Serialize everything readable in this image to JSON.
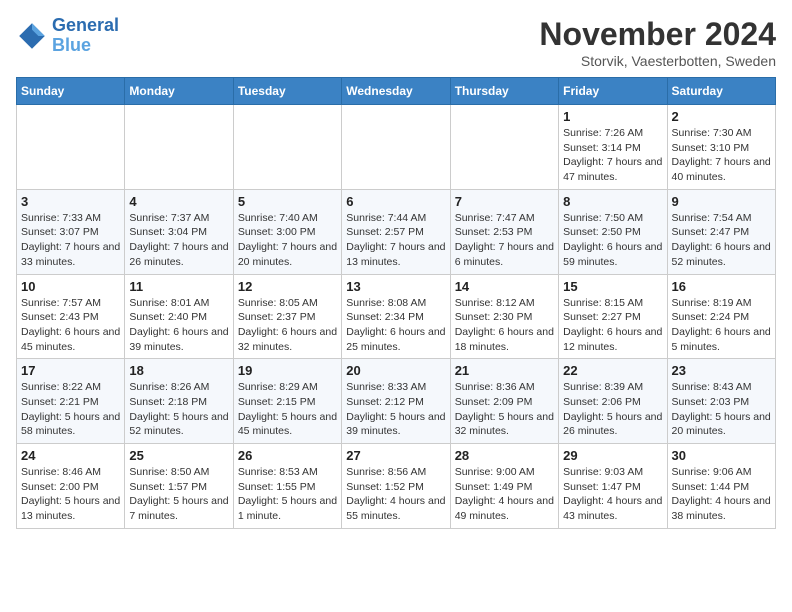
{
  "logo": {
    "line1": "General",
    "line2": "Blue"
  },
  "title": "November 2024",
  "location": "Storvik, Vaesterbotten, Sweden",
  "weekdays": [
    "Sunday",
    "Monday",
    "Tuesday",
    "Wednesday",
    "Thursday",
    "Friday",
    "Saturday"
  ],
  "weeks": [
    [
      {
        "day": "",
        "info": ""
      },
      {
        "day": "",
        "info": ""
      },
      {
        "day": "",
        "info": ""
      },
      {
        "day": "",
        "info": ""
      },
      {
        "day": "",
        "info": ""
      },
      {
        "day": "1",
        "info": "Sunrise: 7:26 AM\nSunset: 3:14 PM\nDaylight: 7 hours and 47 minutes."
      },
      {
        "day": "2",
        "info": "Sunrise: 7:30 AM\nSunset: 3:10 PM\nDaylight: 7 hours and 40 minutes."
      }
    ],
    [
      {
        "day": "3",
        "info": "Sunrise: 7:33 AM\nSunset: 3:07 PM\nDaylight: 7 hours and 33 minutes."
      },
      {
        "day": "4",
        "info": "Sunrise: 7:37 AM\nSunset: 3:04 PM\nDaylight: 7 hours and 26 minutes."
      },
      {
        "day": "5",
        "info": "Sunrise: 7:40 AM\nSunset: 3:00 PM\nDaylight: 7 hours and 20 minutes."
      },
      {
        "day": "6",
        "info": "Sunrise: 7:44 AM\nSunset: 2:57 PM\nDaylight: 7 hours and 13 minutes."
      },
      {
        "day": "7",
        "info": "Sunrise: 7:47 AM\nSunset: 2:53 PM\nDaylight: 7 hours and 6 minutes."
      },
      {
        "day": "8",
        "info": "Sunrise: 7:50 AM\nSunset: 2:50 PM\nDaylight: 6 hours and 59 minutes."
      },
      {
        "day": "9",
        "info": "Sunrise: 7:54 AM\nSunset: 2:47 PM\nDaylight: 6 hours and 52 minutes."
      }
    ],
    [
      {
        "day": "10",
        "info": "Sunrise: 7:57 AM\nSunset: 2:43 PM\nDaylight: 6 hours and 45 minutes."
      },
      {
        "day": "11",
        "info": "Sunrise: 8:01 AM\nSunset: 2:40 PM\nDaylight: 6 hours and 39 minutes."
      },
      {
        "day": "12",
        "info": "Sunrise: 8:05 AM\nSunset: 2:37 PM\nDaylight: 6 hours and 32 minutes."
      },
      {
        "day": "13",
        "info": "Sunrise: 8:08 AM\nSunset: 2:34 PM\nDaylight: 6 hours and 25 minutes."
      },
      {
        "day": "14",
        "info": "Sunrise: 8:12 AM\nSunset: 2:30 PM\nDaylight: 6 hours and 18 minutes."
      },
      {
        "day": "15",
        "info": "Sunrise: 8:15 AM\nSunset: 2:27 PM\nDaylight: 6 hours and 12 minutes."
      },
      {
        "day": "16",
        "info": "Sunrise: 8:19 AM\nSunset: 2:24 PM\nDaylight: 6 hours and 5 minutes."
      }
    ],
    [
      {
        "day": "17",
        "info": "Sunrise: 8:22 AM\nSunset: 2:21 PM\nDaylight: 5 hours and 58 minutes."
      },
      {
        "day": "18",
        "info": "Sunrise: 8:26 AM\nSunset: 2:18 PM\nDaylight: 5 hours and 52 minutes."
      },
      {
        "day": "19",
        "info": "Sunrise: 8:29 AM\nSunset: 2:15 PM\nDaylight: 5 hours and 45 minutes."
      },
      {
        "day": "20",
        "info": "Sunrise: 8:33 AM\nSunset: 2:12 PM\nDaylight: 5 hours and 39 minutes."
      },
      {
        "day": "21",
        "info": "Sunrise: 8:36 AM\nSunset: 2:09 PM\nDaylight: 5 hours and 32 minutes."
      },
      {
        "day": "22",
        "info": "Sunrise: 8:39 AM\nSunset: 2:06 PM\nDaylight: 5 hours and 26 minutes."
      },
      {
        "day": "23",
        "info": "Sunrise: 8:43 AM\nSunset: 2:03 PM\nDaylight: 5 hours and 20 minutes."
      }
    ],
    [
      {
        "day": "24",
        "info": "Sunrise: 8:46 AM\nSunset: 2:00 PM\nDaylight: 5 hours and 13 minutes."
      },
      {
        "day": "25",
        "info": "Sunrise: 8:50 AM\nSunset: 1:57 PM\nDaylight: 5 hours and 7 minutes."
      },
      {
        "day": "26",
        "info": "Sunrise: 8:53 AM\nSunset: 1:55 PM\nDaylight: 5 hours and 1 minute."
      },
      {
        "day": "27",
        "info": "Sunrise: 8:56 AM\nSunset: 1:52 PM\nDaylight: 4 hours and 55 minutes."
      },
      {
        "day": "28",
        "info": "Sunrise: 9:00 AM\nSunset: 1:49 PM\nDaylight: 4 hours and 49 minutes."
      },
      {
        "day": "29",
        "info": "Sunrise: 9:03 AM\nSunset: 1:47 PM\nDaylight: 4 hours and 43 minutes."
      },
      {
        "day": "30",
        "info": "Sunrise: 9:06 AM\nSunset: 1:44 PM\nDaylight: 4 hours and 38 minutes."
      }
    ]
  ]
}
